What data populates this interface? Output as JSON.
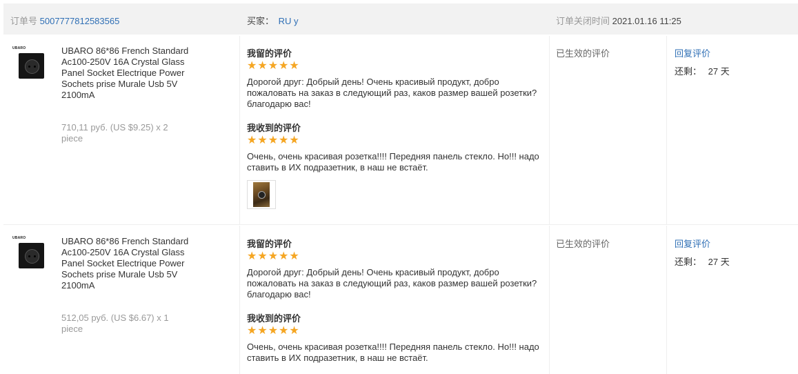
{
  "header": {
    "order_label": "订单号",
    "order_number": "5007777812583565",
    "buyer_label": "买家：",
    "buyer_name": "RU y",
    "close_label": "订单关闭时间",
    "close_time": "2021.01.16 11:25"
  },
  "rows": [
    {
      "brand": "UBARO",
      "product_title": "UBARO 86*86 French Standard Ac100-250V 16A Crystal Glass Panel Socket Electrique Power Sochets prise Murale Usb 5V 2100mA",
      "price": "710,11 руб. (US $9.25) x 2 piece",
      "my_review_label": "我留的评价",
      "my_rating": 5,
      "my_review_text": "Дорогой друг: Добрый день! Очень красивый продукт, добро пожаловать на заказ в следующий раз, каков размер вашей розетки? благодарю вас!",
      "received_review_label": "我收到的评价",
      "received_rating": 5,
      "received_review_text": "Очень, очень красивая розетка!!!! Передняя панель стекло. Но!!! надо ставить в ИХ подразетник, в наш не встаёт.",
      "has_photo": true,
      "status": "已生效的评价",
      "reply_label": "回复评价",
      "remaining_label": "还剩：",
      "remaining_value": "27 天"
    },
    {
      "brand": "UBARO",
      "product_title": "UBARO 86*86 French Standard Ac100-250V 16A Crystal Glass Panel Socket Electrique Power Sochets prise Murale Usb 5V 2100mA",
      "price": "512,05 руб. (US $6.67) x 1 piece",
      "my_review_label": "我留的评价",
      "my_rating": 5,
      "my_review_text": "Дорогой друг: Добрый день! Очень красивый продукт, добро пожаловать на заказ в следующий раз, каков размер вашей розетки? благодарю вас!",
      "received_review_label": "我收到的评价",
      "received_rating": 5,
      "received_review_text": "Очень, очень красивая розетка!!!! Передняя панель стекло. Но!!! надо ставить в ИХ подразетник, в наш не встаёт.",
      "has_photo": false,
      "status": "已生效的评价",
      "reply_label": "回复评价",
      "remaining_label": "还剩：",
      "remaining_value": "27 天"
    }
  ],
  "colors": {
    "link": "#2f6fb5",
    "star": "#f5a623",
    "header_bg": "#f2f2f2",
    "muted": "#999999"
  }
}
